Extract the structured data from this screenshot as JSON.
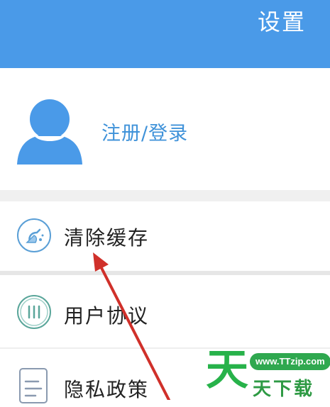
{
  "header": {
    "title": "设置"
  },
  "profile": {
    "login_label": "注册/登录"
  },
  "menu": {
    "items": [
      {
        "label": "清除缓存",
        "icon": "broom-icon"
      },
      {
        "label": "用户协议",
        "icon": "agreement-icon"
      },
      {
        "label": "隐私政策",
        "icon": "document-icon"
      }
    ]
  },
  "watermark": {
    "big_char": "天",
    "site": "www.TTzip.com",
    "name": "天下载"
  },
  "colors": {
    "header": "#4a9ae8",
    "accent": "#3f92d9",
    "annotation_arrow": "#d0302a",
    "watermark": "#27b24a"
  }
}
